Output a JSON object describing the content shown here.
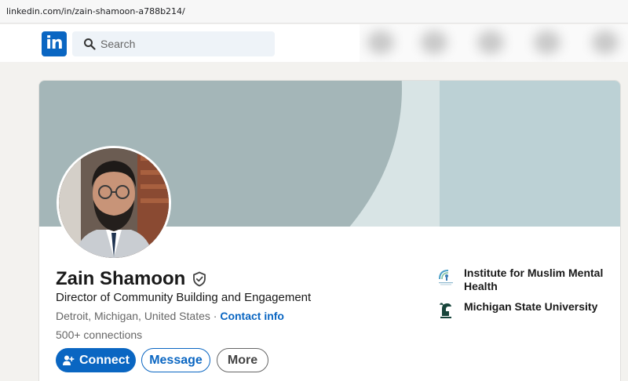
{
  "browser": {
    "url": "linkedin.com/in/zain-shamoon-a788b214/"
  },
  "nav": {
    "logo_text": "in",
    "search_placeholder": "Search"
  },
  "profile": {
    "name": "Zain Shamoon",
    "headline": "Director of Community Building and Engagement",
    "location": "Detroit, Michigan, United States",
    "location_separator": " · ",
    "contact_info": "Contact info",
    "connections": "500+ connections"
  },
  "actions": {
    "connect": "Connect",
    "message": "Message",
    "more": "More"
  },
  "organizations": [
    {
      "name": "Institute for Muslim Mental Health",
      "icon": "institute-logo-icon"
    },
    {
      "name": "Michigan State University",
      "icon": "spartan-helmet-icon"
    }
  ],
  "colors": {
    "brand": "#0a66c2",
    "banner_light": "#bcd1d5",
    "banner_mid": "#d8e4e5",
    "banner_arc": "#a4b6b8"
  }
}
